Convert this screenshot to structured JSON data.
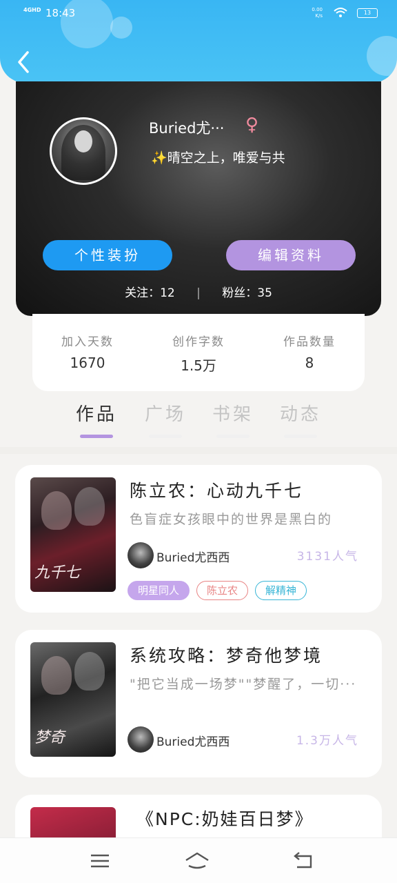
{
  "status_bar": {
    "signal": "4GHD",
    "time": "18:43",
    "net_speed_value": "0.00",
    "net_speed_unit": "K/s",
    "battery": "13"
  },
  "profile": {
    "username": "Buried尤···",
    "gender_symbol": "♀",
    "bio_sparkle": "✨",
    "bio": "晴空之上，唯爱与共",
    "dress_button": "个性装扮",
    "edit_button": "编辑资料",
    "following_label": "关注：",
    "following_count": "12",
    "separator": "|",
    "fans_label": "粉丝：",
    "fans_count": "35"
  },
  "stats": {
    "days_label": "加入天数",
    "days_value": "1670",
    "words_label": "创作字数",
    "words_value": "1.5万",
    "works_label": "作品数量",
    "works_value": "8"
  },
  "tabs": [
    "作品",
    "广场",
    "书架",
    "动态"
  ],
  "books": [
    {
      "title": "陈立农：心动九千七",
      "description": "色盲症女孩眼中的世界是黑白的",
      "author": "Buried尤西西",
      "popularity": "3131人气",
      "cover_text": "九千七",
      "tags": [
        "明星同人",
        "陈立农",
        "解精神"
      ]
    },
    {
      "title": "系统攻略：梦奇他梦境",
      "description": "\"把它当成一场梦\"\"梦醒了，一切···",
      "author": "Buried尤西西",
      "popularity": "1.3万人气",
      "cover_text": "梦奇"
    },
    {
      "title": "《NPC:奶娃百日梦》"
    }
  ],
  "colors": {
    "header_blue": "#39b6f3",
    "accent_purple": "#b394e0",
    "accent_blue": "#1e9af2",
    "gender_pink": "#f18b9e"
  },
  "icons": {
    "back": "chevron-left-icon",
    "menu": "menu-icon",
    "home": "home-icon",
    "return": "return-icon"
  }
}
